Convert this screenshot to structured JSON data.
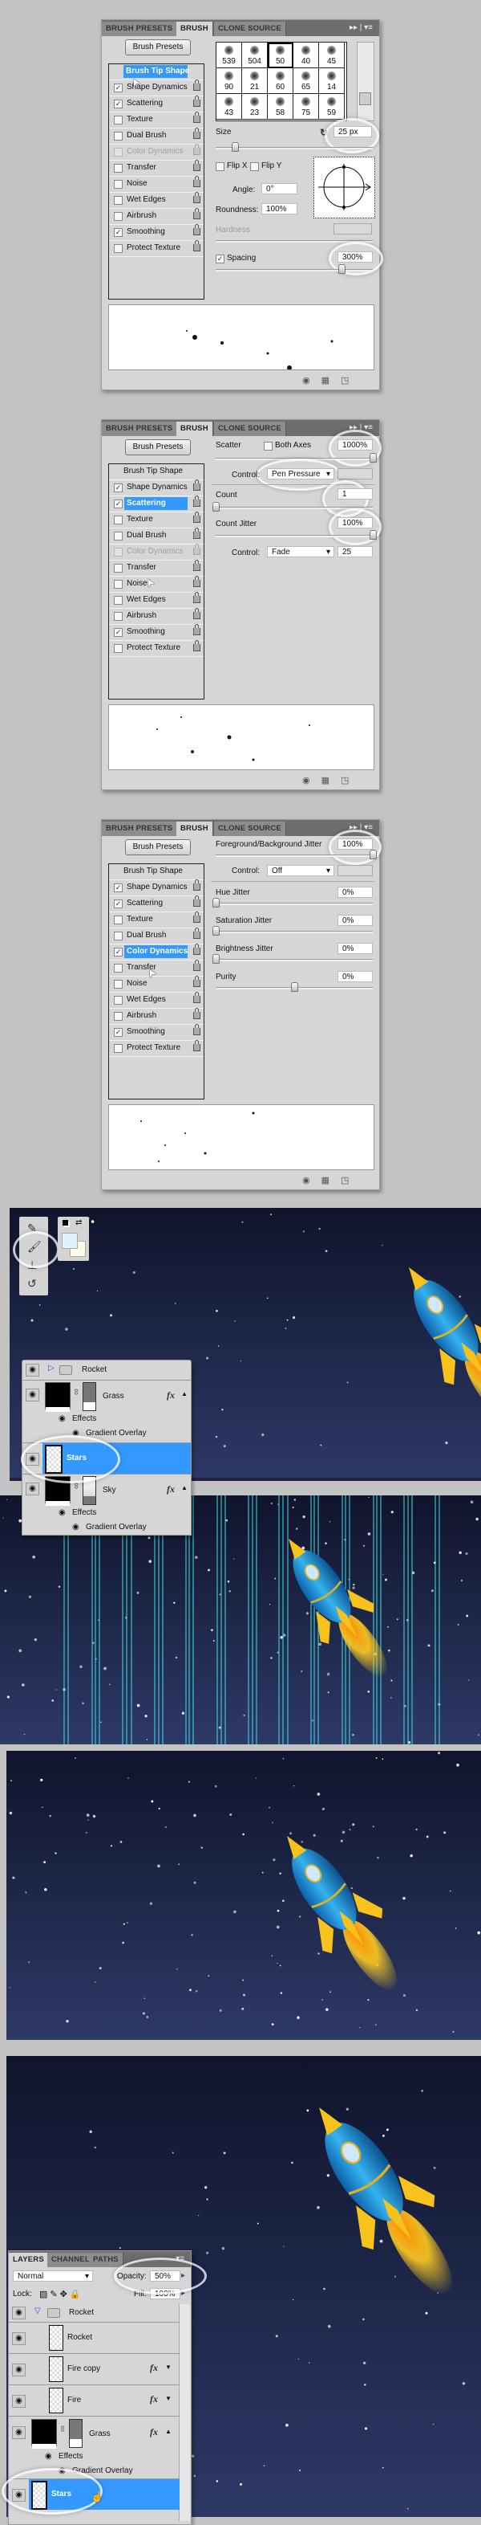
{
  "colors": {
    "selection": "#3399ff",
    "panel_bg": "#d6d6d6",
    "sky_top": "#10142c",
    "sky_bottom": "#2d3a66",
    "guide": "#3fe0e6",
    "rocket_body": "#1d8fd6",
    "rocket_fins": "#f6c21b"
  },
  "brush_panels": [
    {
      "tabs": [
        "BRUSH PRESETS",
        "BRUSH",
        "CLONE SOURCE"
      ],
      "presets_button": "Brush Presets",
      "tip_shape_label": "Brush Tip Shape",
      "selected_item": "Brush Tip Shape",
      "items": [
        {
          "label": "Shape Dynamics",
          "checked": true,
          "disabled": false
        },
        {
          "label": "Scattering",
          "checked": true,
          "disabled": false
        },
        {
          "label": "Texture",
          "checked": false,
          "disabled": false
        },
        {
          "label": "Dual Brush",
          "checked": false,
          "disabled": false
        },
        {
          "label": "Color Dynamics",
          "checked": false,
          "disabled": true
        },
        {
          "label": "Transfer",
          "checked": false,
          "disabled": false
        },
        {
          "label": "Noise",
          "checked": false,
          "disabled": false
        },
        {
          "label": "Wet Edges",
          "checked": false,
          "disabled": false
        },
        {
          "label": "Airbrush",
          "checked": false,
          "disabled": false
        },
        {
          "label": "Smoothing",
          "checked": true,
          "disabled": false
        },
        {
          "label": "Protect Texture",
          "checked": false,
          "disabled": false
        }
      ],
      "brush_tips": [
        "539",
        "504",
        "50",
        "40",
        "45",
        "90",
        "21",
        "60",
        "65",
        "14",
        "43",
        "23",
        "58",
        "75",
        "59"
      ],
      "selected_tip": "50",
      "size_label": "Size",
      "size_value": "25 px",
      "size_slider": 0.12,
      "flip_x": "Flip X",
      "flip_y": "Flip Y",
      "angle_label": "Angle:",
      "angle_value": "0°",
      "roundness_label": "Roundness:",
      "roundness_value": "100%",
      "hardness_label": "Hardness",
      "spacing_label": "Spacing",
      "spacing_checked": true,
      "spacing_value": "300%",
      "spacing_slider": 0.8
    },
    {
      "tabs": [
        "BRUSH PRESETS",
        "BRUSH",
        "CLONE SOURCE"
      ],
      "presets_button": "Brush Presets",
      "tip_shape_label": "Brush Tip Shape",
      "selected_item": "Scattering",
      "items": [
        {
          "label": "Shape Dynamics",
          "checked": true,
          "disabled": false
        },
        {
          "label": "Scattering",
          "checked": true,
          "disabled": false
        },
        {
          "label": "Texture",
          "checked": false,
          "disabled": false
        },
        {
          "label": "Dual Brush",
          "checked": false,
          "disabled": false
        },
        {
          "label": "Color Dynamics",
          "checked": false,
          "disabled": true
        },
        {
          "label": "Transfer",
          "checked": false,
          "disabled": false
        },
        {
          "label": "Noise",
          "checked": false,
          "disabled": false
        },
        {
          "label": "Wet Edges",
          "checked": false,
          "disabled": false
        },
        {
          "label": "Airbrush",
          "checked": false,
          "disabled": false
        },
        {
          "label": "Smoothing",
          "checked": true,
          "disabled": false
        },
        {
          "label": "Protect Texture",
          "checked": false,
          "disabled": false
        }
      ],
      "scatter_label": "Scatter",
      "both_axes_label": "Both Axes",
      "both_axes_checked": false,
      "scatter_value": "1000%",
      "scatter_slider": 1.0,
      "control_label": "Control:",
      "control_value": "Pen Pressure",
      "count_label": "Count",
      "count_value": "1",
      "count_slider": 0.0,
      "count_jitter_label": "Count Jitter",
      "count_jitter_value": "100%",
      "count_jitter_slider": 1.0,
      "control2_label": "Control:",
      "control2_value": "Fade",
      "fade_steps": "25"
    },
    {
      "tabs": [
        "BRUSH PRESETS",
        "BRUSH",
        "CLONE SOURCE"
      ],
      "presets_button": "Brush Presets",
      "tip_shape_label": "Brush Tip Shape",
      "selected_item": "Color Dynamics",
      "items": [
        {
          "label": "Shape Dynamics",
          "checked": true,
          "disabled": false
        },
        {
          "label": "Scattering",
          "checked": true,
          "disabled": false
        },
        {
          "label": "Texture",
          "checked": false,
          "disabled": false
        },
        {
          "label": "Dual Brush",
          "checked": false,
          "disabled": false
        },
        {
          "label": "Color Dynamics",
          "checked": true,
          "disabled": false
        },
        {
          "label": "Transfer",
          "checked": false,
          "disabled": false
        },
        {
          "label": "Noise",
          "checked": false,
          "disabled": false
        },
        {
          "label": "Wet Edges",
          "checked": false,
          "disabled": false
        },
        {
          "label": "Airbrush",
          "checked": false,
          "disabled": false
        },
        {
          "label": "Smoothing",
          "checked": true,
          "disabled": false
        },
        {
          "label": "Protect Texture",
          "checked": false,
          "disabled": false
        }
      ],
      "fg_bg_label": "Foreground/Background Jitter",
      "fg_bg_value": "100%",
      "fg_bg_slider": 1.0,
      "control_label": "Control:",
      "control_value": "Off",
      "hue_label": "Hue Jitter",
      "hue_value": "0%",
      "hue_slider": 0.0,
      "saturation_label": "Saturation Jitter",
      "saturation_value": "0%",
      "saturation_slider": 0.0,
      "brightness_label": "Brightness Jitter",
      "brightness_value": "0%",
      "brightness_slider": 0.0,
      "purity_label": "Purity",
      "purity_value": "0%",
      "purity_slider": 0.5
    }
  ],
  "tools": [
    "quick-selection-tool-icon",
    "brush-tool-icon",
    "clone-stamp-tool-icon",
    "history-brush-tool-icon"
  ],
  "swatches": {
    "foreground": "#dff3ff",
    "background": "#fffbe6"
  },
  "layers_panel_1": {
    "layers": [
      {
        "name": "Rocket",
        "type": "group",
        "expanded": false
      },
      {
        "name": "Grass",
        "type": "fill",
        "fx": true,
        "effects_label": "Effects",
        "effect": "Gradient Overlay"
      },
      {
        "name": "Stars",
        "type": "pixel",
        "selected": true
      },
      {
        "name": "Sky",
        "type": "fill",
        "fx": true,
        "effects_label": "Effects",
        "effect": "Gradient Overlay"
      }
    ]
  },
  "layers_panel_2": {
    "tabs": [
      "LAYERS",
      "CHANNELS",
      "PATHS"
    ],
    "blend_mode": "Normal",
    "opacity_label": "Opacity:",
    "opacity_value": "50%",
    "lock_label": "Lock:",
    "fill_label": "Fill:",
    "fill_value": "100%",
    "layers": [
      {
        "name": "Rocket",
        "type": "group",
        "expanded": true
      },
      {
        "name": "Rocket",
        "type": "pixel",
        "fx": false
      },
      {
        "name": "Fire copy",
        "type": "pixel",
        "fx": true
      },
      {
        "name": "Fire",
        "type": "pixel",
        "fx": true
      },
      {
        "name": "Grass",
        "type": "fill",
        "fx": true,
        "effects_label": "Effects",
        "effect": "Gradient Overlay"
      },
      {
        "name": "Stars",
        "type": "pixel",
        "selected": true
      }
    ]
  }
}
